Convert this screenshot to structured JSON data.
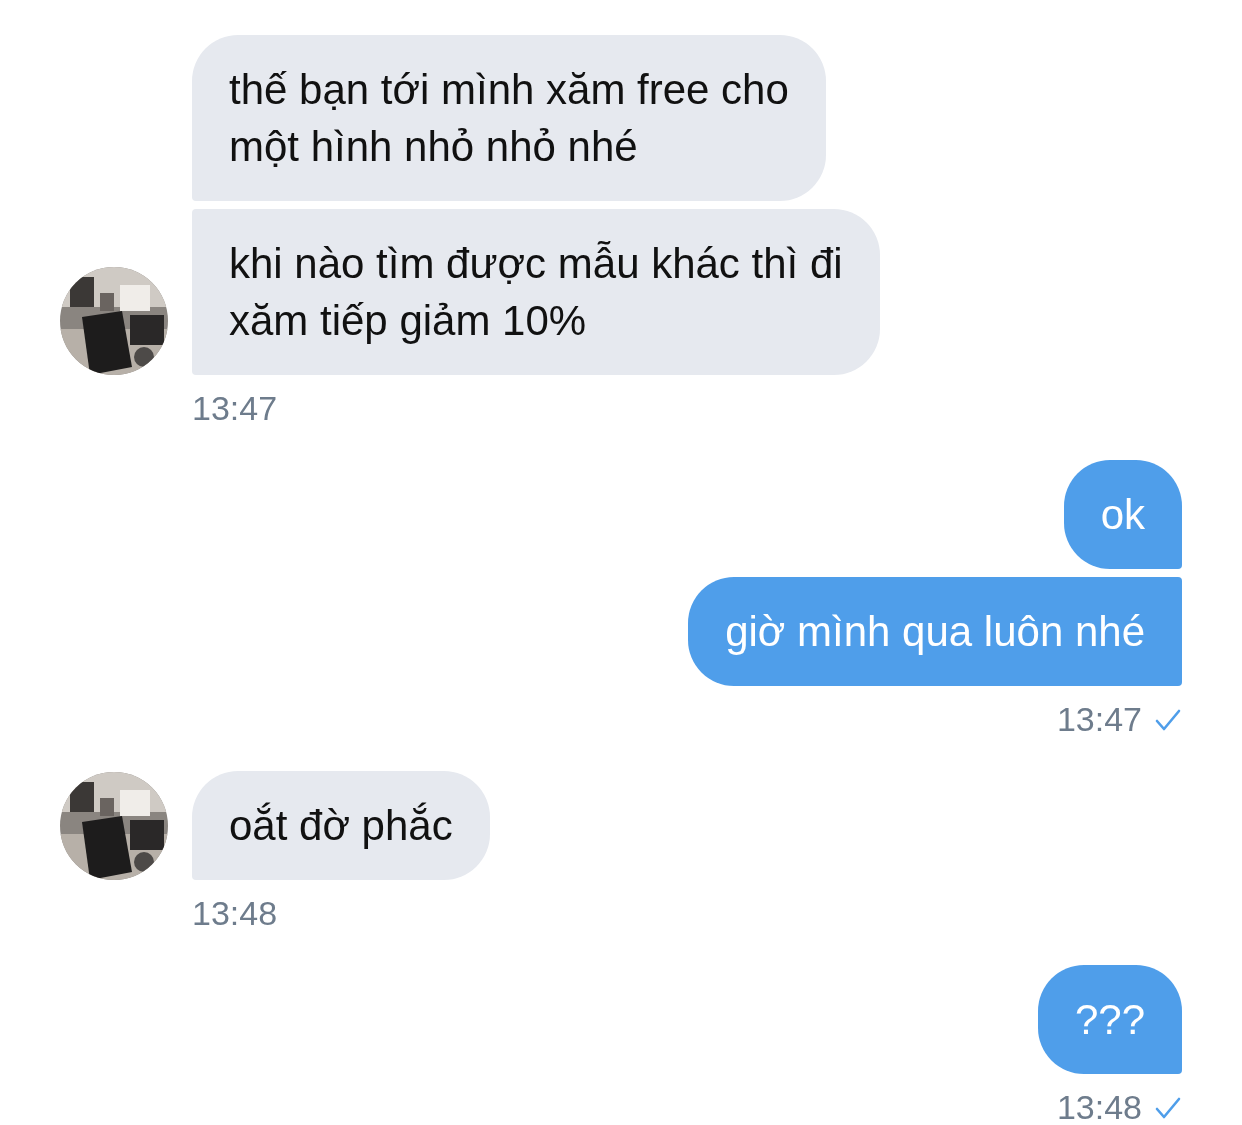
{
  "messages": [
    {
      "kind": "incoming",
      "bubbles": [
        "thế bạn tới mình xăm free cho\nmột hình nhỏ nhỏ nhé",
        "khi nào tìm được mẫu khác thì đi\nxăm tiếp giảm 10%"
      ],
      "time": "13:47",
      "delivered": false
    },
    {
      "kind": "outgoing",
      "bubbles": [
        "ok",
        "giờ mình qua luôn nhé"
      ],
      "time": "13:47",
      "delivered": true
    },
    {
      "kind": "incoming",
      "bubbles": [
        "oắt đờ phắc"
      ],
      "time": "13:48",
      "delivered": false
    },
    {
      "kind": "outgoing",
      "bubbles": [
        "???"
      ],
      "time": "13:48",
      "delivered": true
    }
  ]
}
